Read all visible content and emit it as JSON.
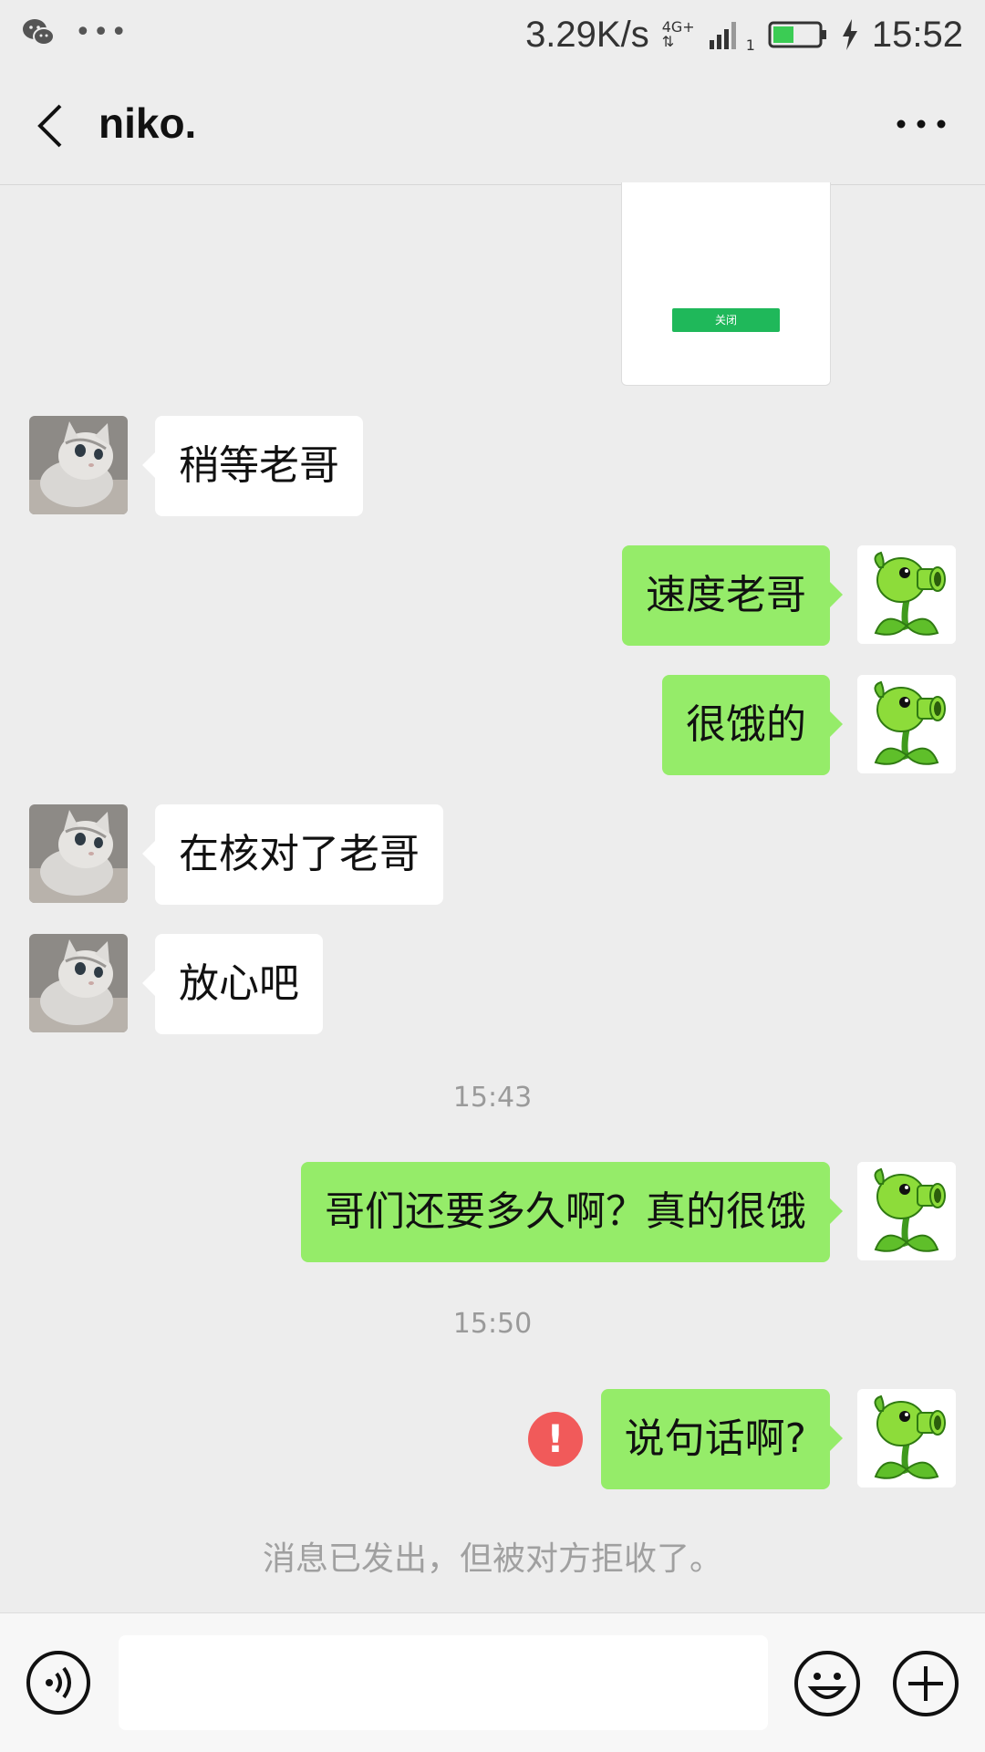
{
  "status_bar": {
    "speed": "3.29K/s",
    "network": "4G+",
    "sim_slot": "1",
    "time": "15:52",
    "battery_level": 0.45,
    "icons": [
      "wechat-icon",
      "more-dots-icon",
      "signal-icon",
      "battery-icon",
      "charging-icon"
    ]
  },
  "header": {
    "title": "niko.",
    "back_icon": "chevron-left-icon",
    "more_icon": "more-horizontal-icon"
  },
  "image_card": {
    "button_label": "关闭"
  },
  "messages": [
    {
      "side": "in",
      "text": "稍等老哥"
    },
    {
      "side": "out",
      "text": "速度老哥"
    },
    {
      "side": "out",
      "text": "很饿的"
    },
    {
      "side": "in",
      "text": "在核对了老哥"
    },
    {
      "side": "in",
      "text": "放心吧"
    },
    {
      "side": "out",
      "text": "哥们还要多久啊？真的很饿"
    },
    {
      "side": "out",
      "text": "说句话啊?",
      "status": "failed"
    }
  ],
  "timestamps": [
    "15:43",
    "15:50"
  ],
  "error_mark": "!",
  "system_notice": "消息已发出，但被对方拒收了。",
  "input_bar": {
    "placeholder": "",
    "value": "",
    "icons": [
      "voice-icon",
      "emoji-icon",
      "plus-icon"
    ]
  },
  "colors": {
    "background": "#ededed",
    "outgoing_bubble": "#95ec69",
    "incoming_bubble": "#ffffff",
    "error": "#f15a5a",
    "wechat_green": "#1fb85a"
  }
}
